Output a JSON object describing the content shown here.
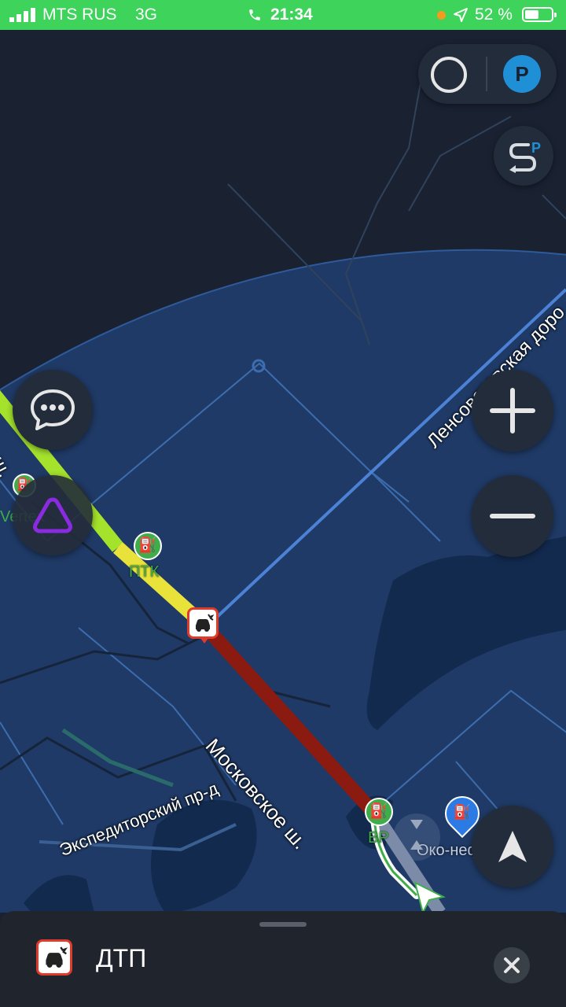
{
  "status_bar": {
    "carrier": "MTS RUS",
    "network": "3G",
    "time": "21:34",
    "battery": "52 %"
  },
  "map": {
    "road_moskovskoe": "Московское ш.",
    "road_moskovskoe_cut": "е ш.",
    "road_lensovetovskaya": "Ленсоветовская доро",
    "road_ekspeditorsky": "Экспедиторский пр-д",
    "poi_verdex": "Vertex",
    "poi_ptk": "ПТК",
    "poi_bp": "BP",
    "poi_oko": "Око-нефть"
  },
  "controls": {
    "parking_label": "P"
  },
  "bottom_sheet": {
    "title": "ДТП"
  },
  "colors": {
    "status_bar": "#3ed35a",
    "map_background": "#1a2232",
    "city_zone": "#1f3a66",
    "traffic_green": "#a4e22c",
    "traffic_yellow": "#e8e23a",
    "traffic_red": "#8b1a10",
    "alice_purple": "#8a2be2",
    "parking_blue": "#1f8fd6"
  }
}
